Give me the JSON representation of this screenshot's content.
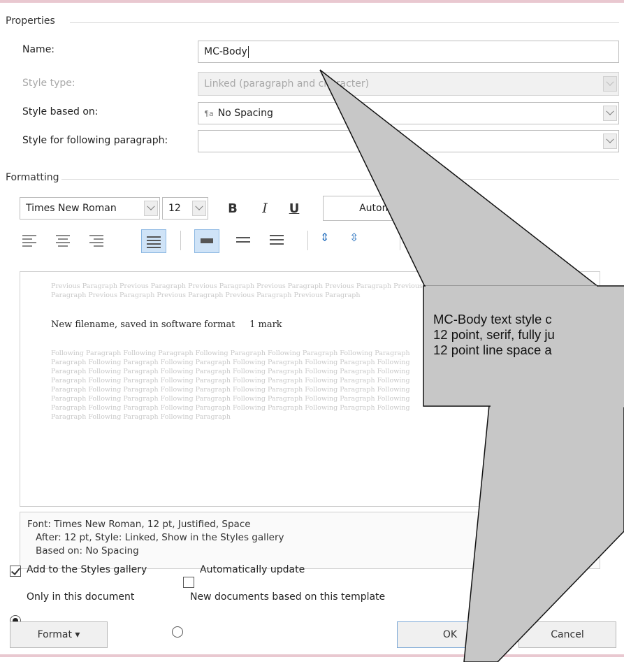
{
  "dialog": {
    "properties_group": "Properties",
    "name_label": "Name:",
    "name_value": "MC-Body",
    "style_type_label": "Style type:",
    "style_type_value": "Linked (paragraph and character)",
    "based_on_label": "Style based on:",
    "based_on_value": "No Spacing",
    "following_label": "Style for following paragraph:",
    "following_value": "",
    "formatting_group": "Formatting",
    "font_name": "Times New Roman",
    "font_size": "12",
    "bold": "B",
    "italic": "I",
    "underline": "U",
    "color_value": "Automatic"
  },
  "preview": {
    "previous_line1": "Previous Paragraph Previous Paragraph Previous Paragraph Previous Paragraph Previous Paragraph Previous",
    "previous_line2": "Paragraph Previous Paragraph Previous Paragraph Previous Paragraph Previous Paragraph",
    "sample_text": "New filename, saved in software format     1 mark",
    "following_lines": [
      "Following Paragraph Following Paragraph Following Paragraph Following Paragraph Following Paragraph",
      "Paragraph Following Paragraph Following Paragraph Following Paragraph Following Paragraph Following",
      "Paragraph Following Paragraph Following Paragraph Following Paragraph Following Paragraph Following",
      "Paragraph Following Paragraph Following Paragraph Following Paragraph Following Paragraph Following",
      "Paragraph Following Paragraph Following Paragraph Following Paragraph Following Paragraph Following",
      "Paragraph Following Paragraph Following Paragraph Following Paragraph Following Paragraph Following",
      "Paragraph Following Paragraph Following Paragraph Following Paragraph Following Paragraph Following",
      "Paragraph Following Paragraph Following Paragraph"
    ]
  },
  "description": {
    "line1": "Font: Times New Roman, 12 pt, Justified, Space",
    "line2": "After:  12 pt, Style: Linked, Show in the Styles gallery",
    "line3": "Based on: No Spacing"
  },
  "options": {
    "add_to_gallery": "Add to the Styles gallery",
    "auto_update": "Automatically update",
    "only_this_doc": "Only in this document",
    "new_docs": "New documents based on this template"
  },
  "buttons": {
    "format": "Format ▾",
    "ok": "OK",
    "cancel": "Cancel"
  },
  "callout": {
    "line1": "MC-Body text style c",
    "line2": "12 point, serif, fully ju",
    "line3": "12 point line space a"
  }
}
